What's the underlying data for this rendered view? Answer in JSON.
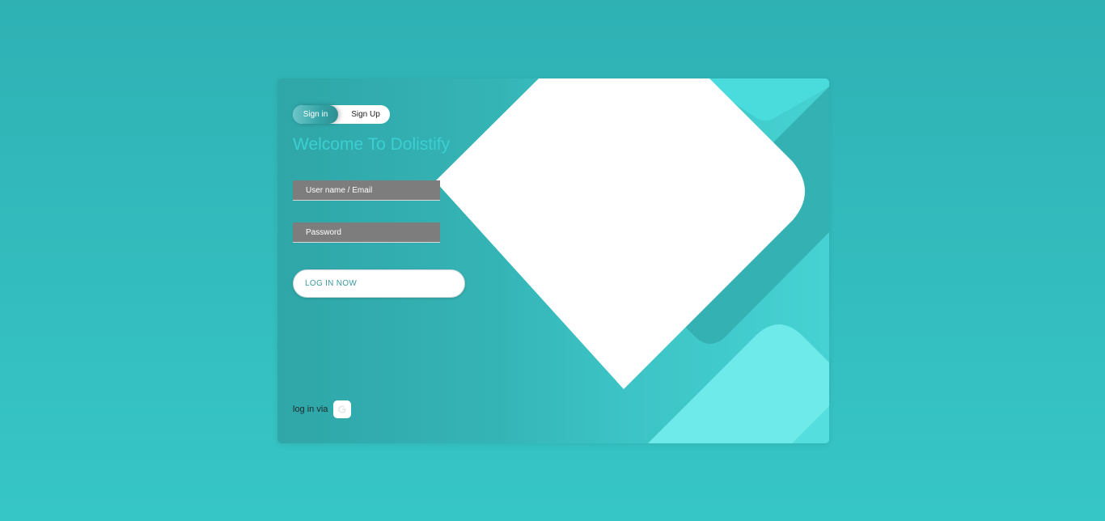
{
  "tabs": {
    "sign_in": "Sign in",
    "sign_up": "Sign Up"
  },
  "welcome": "Welcome To Dolistify",
  "form": {
    "username_placeholder": "User name / Email",
    "password_placeholder": "Password",
    "login_label": "LOG IN NOW"
  },
  "social": {
    "label": "log in via",
    "google_glyph": "G",
    "icon": "google-icon"
  },
  "colors": {
    "accent": "#35b4b6",
    "welcome": "#3ccfd2",
    "field_bg": "#7d7d7d",
    "button_text": "#3a9a9d"
  }
}
